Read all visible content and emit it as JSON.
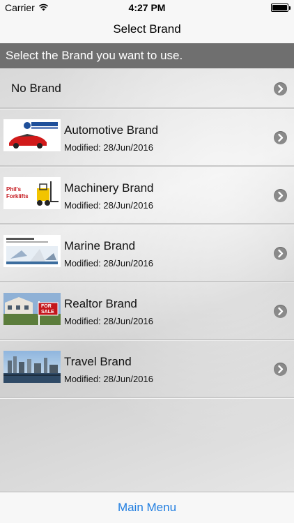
{
  "status_bar": {
    "carrier": "Carrier",
    "time": "4:27 PM",
    "icons": [
      "wifi-icon",
      "battery-icon"
    ]
  },
  "nav": {
    "title": "Select Brand"
  },
  "subheader": {
    "text": "Select the Brand you want to use."
  },
  "list": {
    "no_brand": {
      "label": "No Brand",
      "icon": "chevron-right-icon"
    },
    "brands": [
      {
        "name": "Automotive Brand",
        "modified": "Modified: 28/Jun/2016",
        "thumb": "capitol-chevrolet-thumbnail",
        "thumb_text": "CAPITOL CHEVROLET"
      },
      {
        "name": "Machinery Brand",
        "modified": "Modified: 28/Jun/2016",
        "thumb": "phils-forklifts-thumbnail",
        "thumb_text": "Phil's Forklifts"
      },
      {
        "name": "Marine Brand",
        "modified": "Modified: 28/Jun/2016",
        "thumb": "boat-sales-thumbnail",
        "thumb_text": "ST KILDA BOAT SALES"
      },
      {
        "name": "Realtor Brand",
        "modified": "Modified: 28/Jun/2016",
        "thumb": "for-sale-sign-thumbnail",
        "thumb_text": "FOR SALE"
      },
      {
        "name": "Travel Brand",
        "modified": "Modified: 28/Jun/2016",
        "thumb": "harbor-thumbnail",
        "thumb_text": ""
      }
    ]
  },
  "tab_bar": {
    "main_menu": "Main Menu"
  },
  "colors": {
    "accent": "#1f7de0",
    "subheader_bg": "#6f6f6f",
    "chevron_bg": "#8a8a8a"
  }
}
